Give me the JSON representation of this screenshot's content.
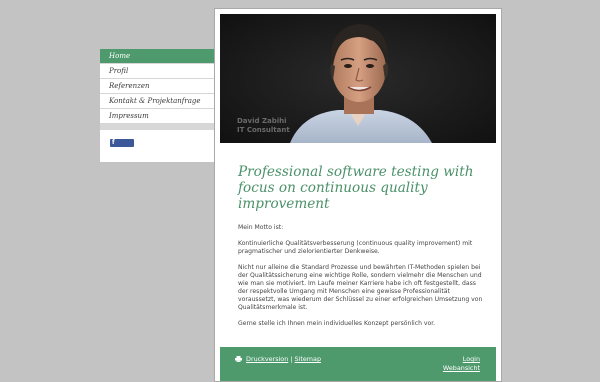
{
  "nav": {
    "items": [
      {
        "label": "Home",
        "active": true
      },
      {
        "label": "Profil"
      },
      {
        "label": "Referenzen"
      },
      {
        "label": "Kontakt & Projektanfrage"
      },
      {
        "label": "Impressum"
      }
    ]
  },
  "header": {
    "caption_name": "David Zabihi",
    "caption_title": "IT Consultant"
  },
  "main": {
    "headline": "Professional software testing with focus on continuous quality improvement",
    "paragraphs": [
      "Mein Motto ist:",
      "Kontinuierliche Qualitätsverbesserung (continuous quality improvement) mit pragmatischer und zielorientierter Denkweise.",
      "Nicht nur alleine die Standard Prozesse und bewährten IT-Methoden spielen bei der Qualitätssicherung eine wichtige Rolle, sondern vielmehr die Menschen und wie man sie motiviert. Im Laufe meiner Karriere habe ich oft festgestellt, dass der respektvolle Umgang mit Menschen eine gewisse Professionalität voraussetzt, was wiederum der Schlüssel zu einer erfolgreichen Umsetzung von Qualitätsmerkmale ist.",
      "Gerne stelle ich Ihnen mein individuelles Konzept persönlich vor."
    ]
  },
  "footer": {
    "print_label": "Druckversion",
    "separator": "|",
    "sitemap_label": "Sitemap",
    "login_label": "Login",
    "web_view_label": "Webansicht"
  },
  "colors": {
    "accent": "#4f9a6d",
    "background": "#c3c3c3"
  },
  "icons": {
    "facebook": "facebook-like-icon",
    "print": "printer-icon"
  }
}
